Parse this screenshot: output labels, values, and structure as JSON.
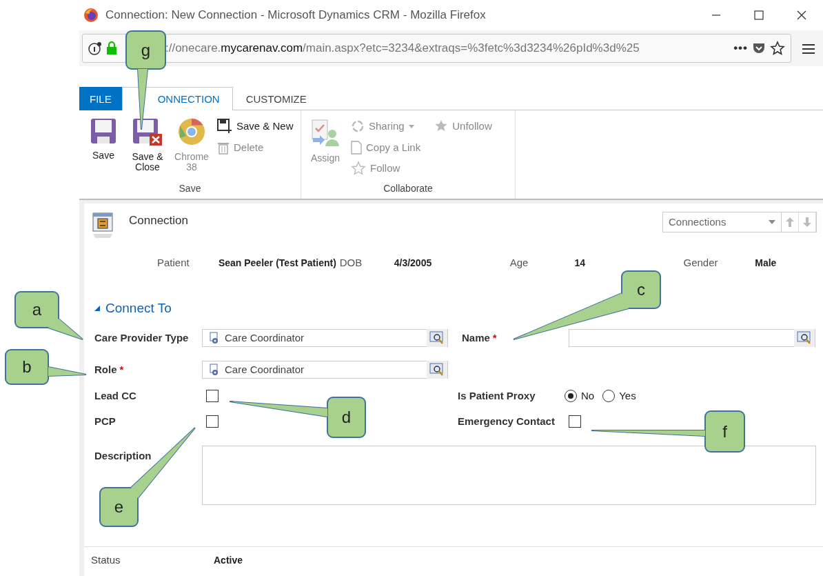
{
  "window": {
    "title": "Connection: New Connection - Microsoft Dynamics CRM - Mozilla Firefox"
  },
  "address_bar": {
    "before": "://onecare.",
    "host": "mycarenav.com",
    "after": "/main.aspx?etc=3234&extraqs=%3fetc%3d3234%26pId%3d%25",
    "more": "•••"
  },
  "ribbon": {
    "tabs": [
      {
        "label": "FILE",
        "kind": "file",
        "selected": false
      },
      {
        "label": "ONNECTION",
        "kind": "tab",
        "selected": true
      },
      {
        "label": "CUSTOMIZE",
        "kind": "tab",
        "selected": false
      }
    ],
    "groups": [
      {
        "label": "Save",
        "columns": [
          [
            {
              "label": "Save",
              "kind": "large",
              "disabled": false
            }
          ],
          [
            {
              "label": "Save & Close",
              "kind": "large",
              "disabled": false
            }
          ],
          [
            {
              "label": "Chrome 38",
              "kind": "large",
              "disabled": true
            }
          ],
          [
            {
              "label": "Save & New",
              "kind": "small",
              "disabled": false
            },
            {
              "label": "Delete",
              "kind": "small",
              "disabled": true
            }
          ]
        ]
      },
      {
        "label": "Collaborate",
        "columns": [
          [
            {
              "label": "Assign",
              "kind": "large",
              "disabled": true
            }
          ],
          [
            {
              "label": "Sharing",
              "kind": "small",
              "disabled": true,
              "dropdown": true
            },
            {
              "label": "Copy a Link",
              "kind": "small",
              "disabled": true
            },
            {
              "label": "Follow",
              "kind": "small",
              "disabled": true
            }
          ],
          [
            {
              "label": "Unfollow",
              "kind": "small",
              "disabled": true
            }
          ]
        ]
      }
    ]
  },
  "form": {
    "title": "Connection",
    "navigator": {
      "value": "Connections"
    },
    "header_fields": [
      {
        "label": "Patient",
        "value": "Sean Peeler (Test Patient)"
      },
      {
        "label": "DOB",
        "value": "4/3/2005"
      },
      {
        "label": "Age",
        "value": "14"
      },
      {
        "label": "Gender",
        "value": "Male"
      }
    ],
    "section": {
      "title": "Connect To",
      "expanded": true
    },
    "rows": [
      [
        {
          "kind": "lookup",
          "label": "Care Provider Type",
          "value": "Care Coordinator"
        },
        {
          "kind": "lookup",
          "label": "Name",
          "required_mark": "*"
        }
      ],
      [
        {
          "kind": "lookup",
          "label": "Role",
          "required_mark": "*",
          "value": "Care Coordinator"
        }
      ],
      [
        {
          "kind": "checkbox",
          "label": "Lead CC",
          "checked": false
        },
        {
          "kind": "radio",
          "label": "Is Patient Proxy",
          "options": [
            {
              "label": "No",
              "selected": true
            },
            {
              "label": "Yes",
              "selected": false
            }
          ]
        }
      ],
      [
        {
          "kind": "checkbox",
          "label": "PCP",
          "checked": false
        },
        {
          "kind": "checkbox",
          "label": "Emergency Contact",
          "checked": false
        }
      ],
      [
        {
          "kind": "textarea",
          "label": "Description"
        }
      ]
    ],
    "footer": {
      "label": "Status",
      "value": "Active"
    }
  },
  "callouts": [
    {
      "label": "g"
    },
    {
      "label": "c"
    },
    {
      "label": "a"
    },
    {
      "label": "b"
    },
    {
      "label": "d"
    },
    {
      "label": "f"
    },
    {
      "label": "e"
    }
  ]
}
